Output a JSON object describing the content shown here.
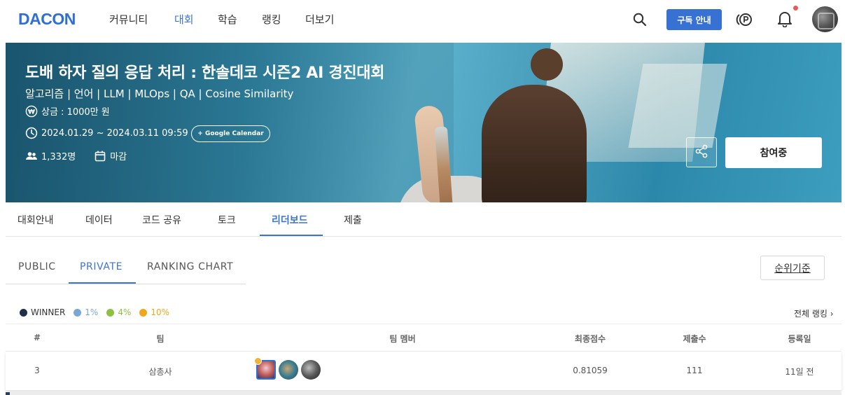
{
  "nav": {
    "logo": "DACON",
    "items": [
      {
        "label": "커뮤니티",
        "active": false
      },
      {
        "label": "대회",
        "active": true
      },
      {
        "label": "학습",
        "active": false
      },
      {
        "label": "랭킹",
        "active": false
      },
      {
        "label": "더보기",
        "active": false
      }
    ],
    "subscribe_label": "구독 안내",
    "icons": [
      "search-icon",
      "point-icon",
      "bell-icon",
      "avatar"
    ],
    "accent_color": "#3771d3",
    "notification_dot_color": "#e85a5a"
  },
  "hero": {
    "title": "도배 하자 질의 응답 처리 : 한솔데코 시즌2 AI 경진대회",
    "tags": "알고리즘 | 언어 | LLM | MLOps | QA | Cosine Similarity",
    "prize": "상금 : 1000만 원",
    "period": "2024.01.29 ~ 2024.03.11 09:59",
    "calendar_label": "+ Google Calendar",
    "participants": "1,332명",
    "status": "마감",
    "join_label": "참여중"
  },
  "tabs": [
    {
      "label": "대회안내",
      "active": false
    },
    {
      "label": "데이터",
      "active": false
    },
    {
      "label": "코드 공유",
      "active": false
    },
    {
      "label": "토크",
      "active": false
    },
    {
      "label": "리더보드",
      "active": true
    },
    {
      "label": "제출",
      "active": false
    }
  ],
  "subtabs": [
    {
      "label": "PUBLIC",
      "active": false
    },
    {
      "label": "PRIVATE",
      "active": true
    },
    {
      "label": "RANKING CHART",
      "active": false
    }
  ],
  "rank_criteria_label": "순위기준",
  "legend": [
    {
      "label": "WINNER",
      "color": "#1e2f4a"
    },
    {
      "label": "1%",
      "color": "#7aa7d6"
    },
    {
      "label": "4%",
      "color": "#8bc23f"
    },
    {
      "label": "10%",
      "color": "#f0a818"
    }
  ],
  "all_ranking_label": "전체 랭킹 ›",
  "table": {
    "headers": [
      "#",
      "팀",
      "팀 멤버",
      "최종점수",
      "제출수",
      "등록일"
    ],
    "rows": [
      {
        "rank": "3",
        "team": "삼총사",
        "score": "0.81059",
        "submissions": "111",
        "date": "11일 전"
      }
    ]
  }
}
